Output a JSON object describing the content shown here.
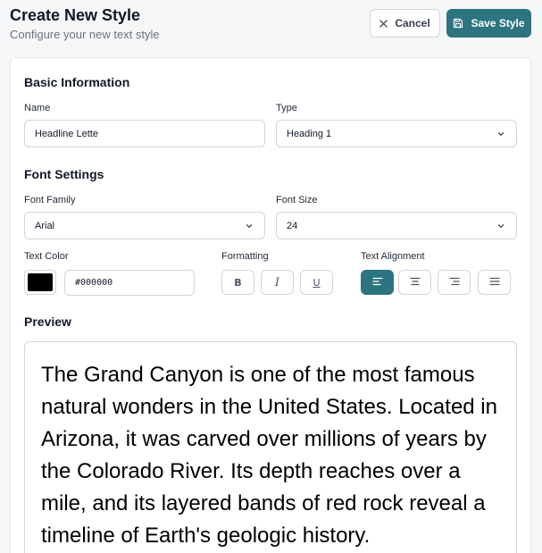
{
  "header": {
    "title": "Create New Style",
    "subtitle": "Configure your new text style",
    "cancel_label": "Cancel",
    "save_label": "Save Style"
  },
  "basic_info": {
    "section_title": "Basic Information",
    "name_label": "Name",
    "name_value": "Headline Lette",
    "type_label": "Type",
    "type_value": "Heading 1"
  },
  "font_settings": {
    "section_title": "Font Settings",
    "family_label": "Font Family",
    "family_value": "Arial",
    "size_label": "Font Size",
    "size_value": "24",
    "color_label": "Text Color",
    "color_value": "#000000",
    "formatting_label": "Formatting",
    "formatting_buttons": [
      "B",
      "I",
      "U"
    ],
    "alignment_label": "Text Alignment",
    "alignment_options": [
      "left",
      "center",
      "right",
      "justify"
    ],
    "alignment_selected": "left"
  },
  "preview": {
    "section_title": "Preview",
    "text": "The Grand Canyon is one of the most famous natural wonders in the United States. Located in Arizona, it was carved over millions of years by the Colorado River. Its depth reaches over a mile, and its layered bands of red rock reveal a timeline of Earth's geologic history."
  },
  "colors": {
    "accent": "#2c7480",
    "text_color": "#000000"
  },
  "icons": {
    "cancel": "close-icon",
    "save": "save-icon",
    "select": "chevron-down-icon",
    "align": [
      "align-left-icon",
      "align-center-icon",
      "align-right-icon",
      "align-justify-icon"
    ]
  }
}
